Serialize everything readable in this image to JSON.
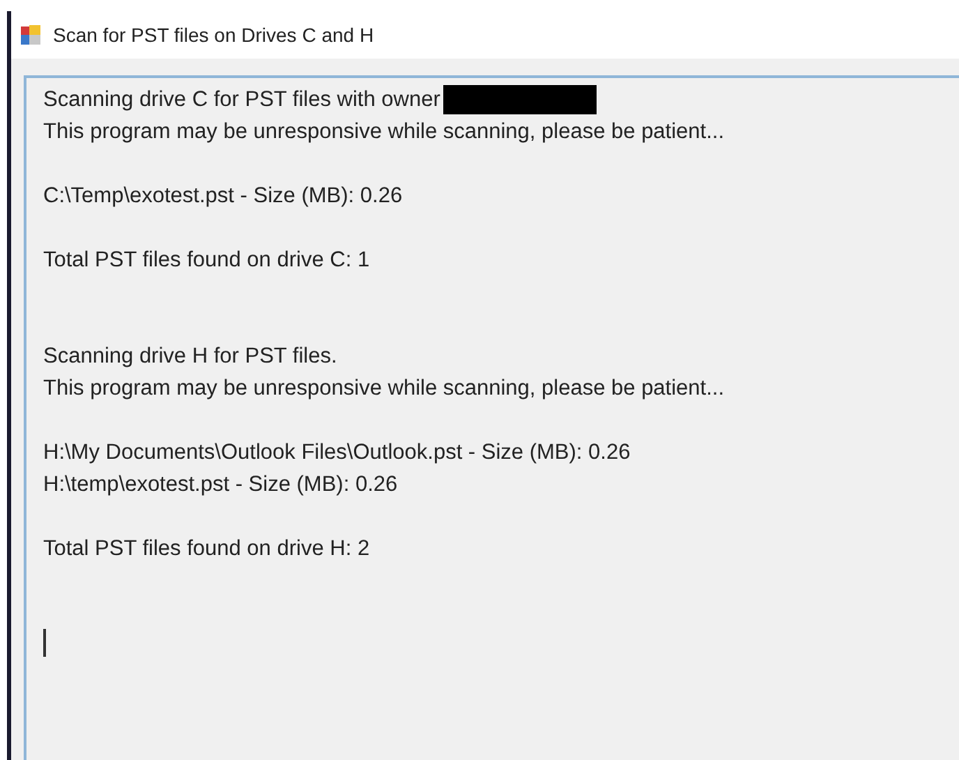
{
  "window": {
    "title": "Scan for PST files on Drives C and H"
  },
  "output": {
    "sections": [
      {
        "paragraphs": [
          {
            "lines": [
              {
                "text": "Scanning drive C for PST files with owner",
                "redacted": true
              },
              {
                "text": "This program may be unresponsive while scanning, please be patient...",
                "redacted": false
              }
            ]
          },
          {
            "lines": [
              {
                "text": "C:\\Temp\\exotest.pst - Size (MB): 0.26",
                "redacted": false
              }
            ]
          },
          {
            "lines": [
              {
                "text": "Total PST files found on drive C: 1",
                "redacted": false
              }
            ]
          }
        ]
      },
      {
        "paragraphs": [
          {
            "lines": [
              {
                "text": "Scanning drive H for PST files.",
                "redacted": false
              },
              {
                "text": "This program may be unresponsive while scanning, please be patient...",
                "redacted": false
              }
            ]
          },
          {
            "lines": [
              {
                "text": "H:\\My Documents\\Outlook Files\\Outlook.pst - Size (MB): 0.26",
                "redacted": false
              },
              {
                "text": "H:\\temp\\exotest.pst - Size (MB): 0.26",
                "redacted": false
              }
            ]
          },
          {
            "lines": [
              {
                "text": "Total PST files found on drive H: 2",
                "redacted": false
              }
            ]
          }
        ]
      }
    ]
  }
}
